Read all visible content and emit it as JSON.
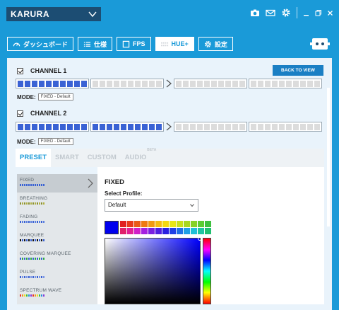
{
  "window": {
    "device_name": "KARURA",
    "icons": [
      "camera-icon",
      "mail-icon",
      "gear-icon"
    ],
    "controls": [
      "minimize-button",
      "restore-button",
      "close-button"
    ]
  },
  "nav": {
    "tabs": [
      {
        "label": "ダッシュボード",
        "icon": "speedometer-icon",
        "active": false
      },
      {
        "label": "仕様",
        "icon": "list-icon",
        "active": false
      },
      {
        "label": "FPS",
        "icon": "frame-icon",
        "active": false
      },
      {
        "label": "HUE+",
        "icon": "led-grid-icon",
        "active": true
      },
      {
        "label": "設定",
        "icon": "gear-icon",
        "active": false
      }
    ],
    "device_icon": "hue-device-icon"
  },
  "channels": [
    {
      "label": "CHANNEL 1",
      "checked": true,
      "mode_label": "MODE:",
      "mode_value": "FIXED - Default",
      "groups": [
        {
          "leds": 10,
          "on": 10
        },
        {
          "leds": 10,
          "on": 0
        },
        {
          "leds": 10,
          "on": 0
        },
        {
          "leds": 10,
          "on": 0
        }
      ]
    },
    {
      "label": "CHANNEL 2",
      "checked": true,
      "mode_label": "MODE:",
      "mode_value": "FIXED - Default",
      "groups": [
        {
          "leds": 10,
          "on": 10
        },
        {
          "leds": 10,
          "on": 10
        },
        {
          "leds": 10,
          "on": 0
        },
        {
          "leds": 10,
          "on": 0
        }
      ]
    }
  ],
  "back_to_view": "BACK TO VIEW",
  "effect_tabs": [
    {
      "label": "PRESET",
      "active": true
    },
    {
      "label": "SMART",
      "active": false
    },
    {
      "label": "CUSTOM",
      "active": false
    },
    {
      "label": "AUDIO",
      "active": false,
      "badge": "BETA"
    }
  ],
  "effects": [
    {
      "label": "FIXED",
      "active": true,
      "swatch": [
        "#3a62d4"
      ]
    },
    {
      "label": "BREATHING",
      "active": false,
      "swatch": [
        "#8a8f30",
        "#b0b040"
      ]
    },
    {
      "label": "FADING",
      "active": false,
      "swatch": [
        "#3a62d4",
        "#5b7fe0"
      ]
    },
    {
      "label": "MARQUEE",
      "active": false,
      "swatch": [
        "#111111",
        "#3a62d4"
      ]
    },
    {
      "label": "COVERING MARQUEE",
      "active": false,
      "swatch": [
        "#3a62d4",
        "#2aa845"
      ]
    },
    {
      "label": "PULSE",
      "active": false,
      "swatch": [
        "#3a62d4",
        "#7a95e6"
      ]
    },
    {
      "label": "SPECTRUM WAVE",
      "active": false,
      "swatch": [
        "#e8302a",
        "#f39a1e",
        "#f0e020",
        "#39c23c",
        "#2a8fe0",
        "#8a3ad8"
      ]
    }
  ],
  "detail": {
    "title": "FIXED",
    "select_label": "Select Profile:",
    "profile_value": "Default",
    "current_color": "#0000ee",
    "palette": [
      "#e02020",
      "#e83a1a",
      "#ea5a16",
      "#ee7a12",
      "#f29a12",
      "#f6bb12",
      "#f4d812",
      "#e6e618",
      "#c8e01c",
      "#a8d820",
      "#86d226",
      "#5ccc34",
      "#3ec03e",
      "#e0206a",
      "#e02096",
      "#d020c8",
      "#a420e0",
      "#7a20e0",
      "#5020e0",
      "#2a20e0",
      "#2040e6",
      "#2070e6",
      "#20a0e6",
      "#20c0d8",
      "#20c4a0",
      "#20c070"
    ]
  }
}
